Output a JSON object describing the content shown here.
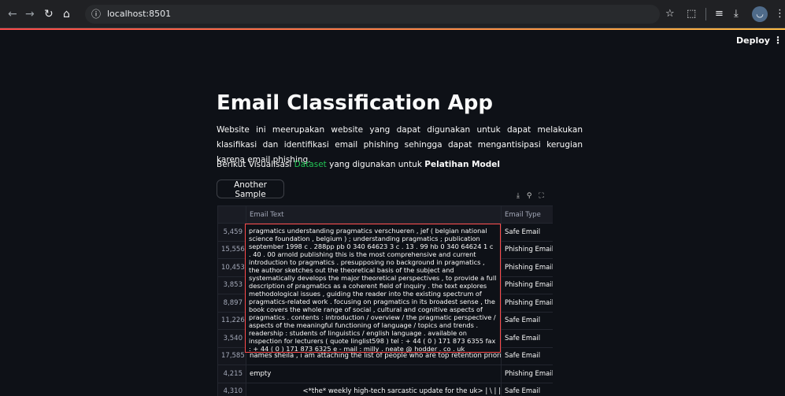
{
  "browser": {
    "url": "localhost:8501",
    "site_info_icon": "info-icon",
    "icons": [
      "back-arrow-icon",
      "forward-arrow-icon",
      "reload-icon",
      "home-icon",
      "star-icon",
      "extensions-icon",
      "reading-list-icon",
      "download-icon",
      "profile-icon",
      "more-icon"
    ]
  },
  "header": {
    "deploy_label": "Deploy",
    "menu_icon": "kebab-menu-icon"
  },
  "app": {
    "title": "Email Classification App",
    "description": "Website ini meerupakan website yang dapat digunakan untuk dapat melakukan klasifikasi dan identifikasi email phishing sehingga dapat mengantisipasi kerugian karena email phishing.",
    "intro_prefix": "Berikut Visualisasi",
    "intro_link": "Dataset",
    "intro_middle": "yang digunakan untuk",
    "intro_bold": "Pelatihan Model",
    "button_label": "Another Sample",
    "accent_color": "#ff4b4b",
    "link_color": "#21c354"
  },
  "table": {
    "toolbar_icons": [
      "download-icon",
      "search-icon",
      "fullscreen-icon"
    ],
    "columns": [
      "",
      "Email Text",
      "Email Type"
    ],
    "rows": [
      {
        "index": "5,459",
        "text": "",
        "type": "Safe Email"
      },
      {
        "index": "15,556",
        "text": "",
        "type": "Phishing Email"
      },
      {
        "index": "10,453",
        "text": "",
        "type": "Phishing Email"
      },
      {
        "index": "3,853",
        "text": "",
        "type": "Phishing Email"
      },
      {
        "index": "8,897",
        "text": "",
        "type": "Phishing Email"
      },
      {
        "index": "11,226",
        "text": "",
        "type": "Safe Email"
      },
      {
        "index": "3,540",
        "text": "",
        "type": "Safe Email"
      },
      {
        "index": "17,585",
        "text": "names sheila , i am attaching the list of people who are top retention priority . the list",
        "type": "Safe Email"
      },
      {
        "index": "4,215",
        "text": "empty",
        "type": "Phishing Email"
      },
      {
        "index": "4,310",
        "text": "                         <*the* weekly high-tech sarcastic update for the uk> | \\ | |     | | / /",
        "type": "Safe Email"
      }
    ],
    "expanded_cell": "pragmatics understanding pragmatics verschueren , jef ( belgian national science foundation , belgium ) ; understanding pragmatics ; publication september 1998 c . 288pp pb 0 340 64623 3 c . 13 . 99 hb 0 340 64624 1 c . 40 . 00 arnold publishing this is the most comprehensive and current introduction to pragmatics . presupposing no background in pragmatics , the author sketches out the theoretical basis of the subject and systematically develops the major theoretical perspectives , to provide a full description of pragmatics as a coherent field of inquiry . the text explores methodological issues , guiding the reader into the existing spectrum of pragmatics-related work . focusing on pragmatics in its broadest sense , the book covers the whole range of social , cultural and cognitive aspects of pragmatics . contents : introduction / overview / the pragmatic perspective / aspects of the meaningful functioning of language / topics and trends . readership : students of linguistics / english language . available on inspection for lecturers ( quote linglist598 ) tel : + 44 ( 0 ) 171 873 6355 fax : + 44 ( 0 ) 171 873 6325 e - mail : milly . neate @ hodder . co . uk"
  }
}
